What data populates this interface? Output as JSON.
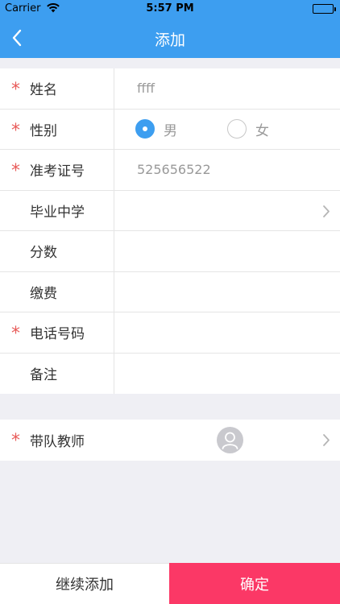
{
  "status_bar": {
    "carrier": "Carrier",
    "time": "5:57 PM"
  },
  "nav": {
    "title": "添加",
    "back_icon": "chevron-left-icon"
  },
  "form": {
    "required_mark": "*",
    "name": {
      "label": "姓名",
      "value": "ffff",
      "required": true
    },
    "gender": {
      "label": "性别",
      "required": true,
      "options": [
        "男",
        "女"
      ],
      "selected": "男"
    },
    "exam_id": {
      "label": "准考证号",
      "value": "525656522",
      "required": true
    },
    "school": {
      "label": "毕业中学",
      "value": "",
      "required": false
    },
    "score": {
      "label": "分数",
      "value": "",
      "required": false
    },
    "fee": {
      "label": "缴费",
      "value": "",
      "required": false
    },
    "phone": {
      "label": "电话号码",
      "value": "",
      "required": true
    },
    "remark": {
      "label": "备注",
      "value": "",
      "required": false
    }
  },
  "teacher": {
    "label": "带队教师",
    "required": true,
    "avatar_icon": "person-icon"
  },
  "actions": {
    "continue_label": "继续添加",
    "confirm_label": "确定"
  },
  "colors": {
    "primary": "#3d9ef0",
    "required": "#e85b59",
    "confirm": "#fb3866",
    "background": "#efeff4"
  }
}
